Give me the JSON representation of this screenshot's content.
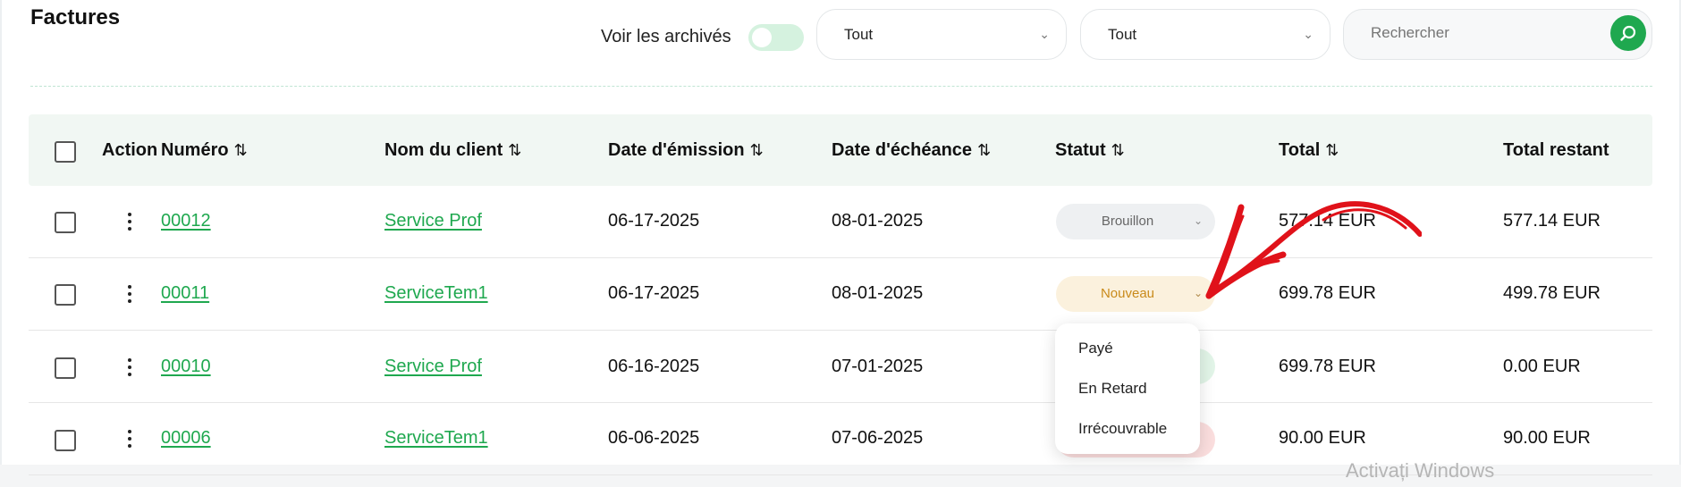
{
  "page": {
    "title": "Factures"
  },
  "filters": {
    "archive_label": "Voir les archivés",
    "archive_on": false,
    "select1_value": "Tout",
    "select2_value": "Tout",
    "search_placeholder": "Rechercher"
  },
  "table": {
    "headers": {
      "action": "Action",
      "numero": "Numéro",
      "client": "Nom du client",
      "emission": "Date d'émission",
      "echeance": "Date d'échéance",
      "statut": "Statut",
      "total": "Total",
      "restant": "Total restant"
    },
    "sort_glyph": "⇅",
    "rows": [
      {
        "numero": "00012",
        "client": "Service Prof",
        "emission": "06-17-2025",
        "echeance": "08-01-2025",
        "statut": "Brouillon",
        "total": "577.14 EUR",
        "restant": "577.14 EUR"
      },
      {
        "numero": "00011",
        "client": "ServiceTem1",
        "emission": "06-17-2025",
        "echeance": "08-01-2025",
        "statut": "Nouveau",
        "total": "699.78 EUR",
        "restant": "499.78 EUR"
      },
      {
        "numero": "00010",
        "client": "Service Prof",
        "emission": "06-16-2025",
        "echeance": "07-01-2025",
        "statut": "",
        "total": "699.78 EUR",
        "restant": "0.00 EUR"
      },
      {
        "numero": "00006",
        "client": "ServiceTem1",
        "emission": "06-06-2025",
        "echeance": "07-06-2025",
        "statut": "",
        "total": "90.00 EUR",
        "restant": "90.00 EUR"
      }
    ]
  },
  "status_dropdown": {
    "options": [
      "Payé",
      "En Retard",
      "Irrécouvrable"
    ]
  },
  "watermark": "Activați Windows",
  "colors": {
    "accent": "#1fa84f",
    "header_bg": "#f1f7f3",
    "brouillon_bg": "#eef0f2",
    "nouveau_bg": "#fbf1dd",
    "nouveau_text": "#c98a1a",
    "annotation": "#e0121a"
  },
  "icons": [
    "search-icon",
    "chevron-down-icon",
    "sort-icon",
    "kebab-icon",
    "annotation-arrow"
  ]
}
